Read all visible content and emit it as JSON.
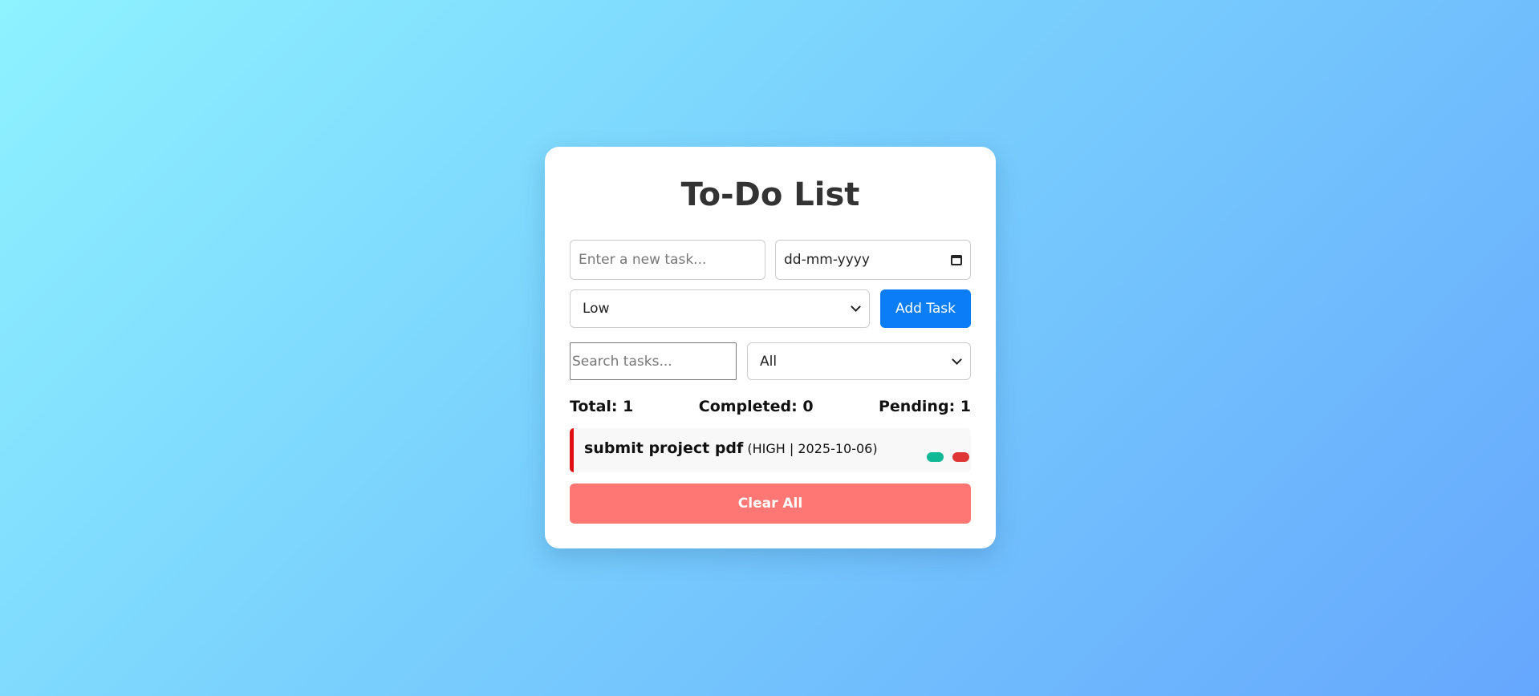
{
  "app": {
    "title": "To-Do List"
  },
  "form": {
    "task_placeholder": "Enter a new task...",
    "task_value": "",
    "date_placeholder": "dd-mm-yyyy",
    "priority_selected": "Low",
    "add_label": "Add Task"
  },
  "filters": {
    "search_placeholder": "Search tasks...",
    "status_selected": "All"
  },
  "stats": {
    "total": "Total: 1",
    "completed": "Completed: 0",
    "pending": "Pending: 1"
  },
  "tasks": [
    {
      "name": "submit project pdf",
      "meta": "(HIGH | 2025-10-06)",
      "priority_color": "#e01010"
    }
  ],
  "actions": {
    "clear_label": "Clear All"
  },
  "colors": {
    "accent": "#0a7df7",
    "danger": "#ff7775",
    "complete_button": "#10b895",
    "delete_button": "#e03535"
  }
}
